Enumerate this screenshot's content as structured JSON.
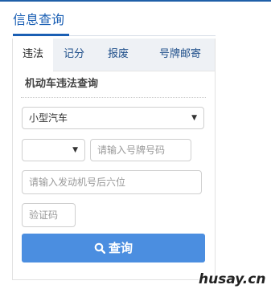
{
  "header": {
    "title": "信息查询"
  },
  "tabs": [
    {
      "label": "违法",
      "active": true
    },
    {
      "label": "记分",
      "active": false
    },
    {
      "label": "报废",
      "active": false
    },
    {
      "label": "号牌邮寄",
      "active": false
    }
  ],
  "form": {
    "title": "机动车违法查询",
    "vehicle_type": {
      "value": "小型汽车"
    },
    "province": {
      "value": ""
    },
    "plate": {
      "placeholder": "请输入号牌号码"
    },
    "engine": {
      "placeholder": "请输入发动机号后六位"
    },
    "captcha": {
      "placeholder": "验证码"
    },
    "submit_label": "查询"
  },
  "watermark": "husay.cn",
  "colors": {
    "accent": "#1a5fb4",
    "button": "#4b8ee0"
  }
}
